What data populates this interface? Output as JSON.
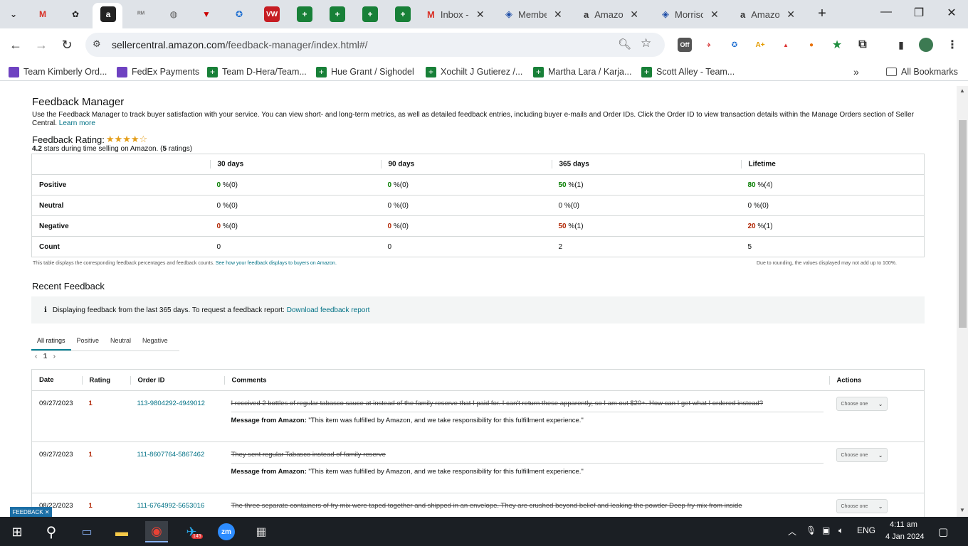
{
  "tabs": {
    "named": [
      {
        "label": "Inbox -",
        "icon": "gmail-icon"
      },
      {
        "label": "Membe",
        "icon": "diamond-icon"
      },
      {
        "label": "Amazo",
        "icon": "amazon-icon"
      },
      {
        "label": "Morriso",
        "icon": "diamond-icon"
      },
      {
        "label": "Amazo",
        "icon": "amazon-icon"
      }
    ]
  },
  "browser": {
    "url_domain": "sellercentral.amazon.com",
    "url_path": "/feedback-manager/index.html#/"
  },
  "bookmarks": [
    {
      "label": "Team Kimberly Ord..."
    },
    {
      "label": "FedEx Payments"
    },
    {
      "label": "Team D-Hera/Team..."
    },
    {
      "label": "Hue Grant / Sighodel"
    },
    {
      "label": "Xochilt J Gutierez /..."
    },
    {
      "label": "Martha Lara / Karja..."
    },
    {
      "label": "Scott Alley - Team..."
    }
  ],
  "bookmarks_all": "All Bookmarks",
  "page": {
    "title": "Feedback Manager",
    "description": "Use the Feedback Manager to track buyer satisfaction with your service. You can view short- and long-term metrics, as well as detailed feedback entries, including buyer e-mails and Order IDs. Click the Order ID to view transaction details within the Manage Orders section of Seller Central.",
    "learn_more": "Learn more",
    "rating_label": "Feedback Rating:",
    "rating_stars": "★★★★☆",
    "rating_value": "4.2",
    "rating_text_a": " stars during time selling on Amazon. (",
    "rating_count": "5",
    "rating_text_b": " ratings)"
  },
  "metrics": {
    "headers": [
      "30 days",
      "90 days",
      "365 days",
      "Lifetime"
    ],
    "rows": [
      {
        "label": "Positive",
        "cells": [
          [
            "0",
            "%(0)"
          ],
          [
            "0",
            "%(0)"
          ],
          [
            "50",
            "%(1)"
          ],
          [
            "80",
            "%(4)"
          ]
        ]
      },
      {
        "label": "Neutral",
        "cells": [
          [
            "0",
            "%(0)"
          ],
          [
            "0",
            "%(0)"
          ],
          [
            "0",
            "%(0)"
          ],
          [
            "0",
            "%(0)"
          ]
        ]
      },
      {
        "label": "Negative",
        "cells": [
          [
            "0",
            "%(0)"
          ],
          [
            "0",
            "%(0)"
          ],
          [
            "50",
            "%(1)"
          ],
          [
            "20",
            "%(1)"
          ]
        ]
      },
      {
        "label": "Count",
        "cells": [
          [
            "0",
            ""
          ],
          [
            "0",
            ""
          ],
          [
            "2",
            ""
          ],
          [
            "5",
            ""
          ]
        ]
      }
    ],
    "footnote_left": "This table displays the corresponding feedback percentages and feedback counts.",
    "footnote_link": "See how your feedback displays to buyers on Amazon.",
    "footnote_right": "Due to rounding, the values displayed may not add up to 100%."
  },
  "recent": {
    "title": "Recent Feedback",
    "info": "Displaying feedback from the last 365 days. To request a feedback report:",
    "info_link": "Download feedback report",
    "tabs": [
      "All ratings",
      "Positive",
      "Neutral",
      "Negative"
    ],
    "page": "1",
    "columns": [
      "Date",
      "Rating",
      "Order ID",
      "Comments",
      "Actions"
    ],
    "rows": [
      {
        "date": "09/27/2023",
        "rating": "1",
        "order": "113-9804292-4949012",
        "comment": "I received 2 bottles of regular tabasco sauce at instead of the family reserve that I paid for. I can't return these apparently, so I am out $20+. How can I get what I ordered instead?",
        "msg_label": "Message from Amazon:",
        "msg": "\"This item was fulfilled by Amazon, and we take responsibility for this fulfillment experience.\"",
        "action": "Choose one"
      },
      {
        "date": "09/27/2023",
        "rating": "1",
        "order": "111-8607764-5867462",
        "comment": "They sent regular Tabasco instead of family reserve",
        "msg_label": "Message from Amazon:",
        "msg": "\"This item was fulfilled by Amazon, and we take responsibility for this fulfillment experience.\"",
        "action": "Choose one"
      },
      {
        "date": "08/22/2023",
        "rating": "1",
        "order": "111-6764992-5653016",
        "comment": "The three separate containers of fry mix were taped together and shipped in an envelope. They are crushed beyond belief and leaking the powder Deep fry mix from inside",
        "msg_label": "",
        "msg": "",
        "action": "Choose one"
      }
    ],
    "feedback_tag": "FEEDBACK"
  },
  "taskbar": {
    "lang": "ENG",
    "time": "4:11 am",
    "date": "4 Jan 2024",
    "telegram_badge": "145"
  },
  "colors": {
    "positive": "#067d00",
    "negative": "#b12704",
    "link": "#007185",
    "star": "#e49e1a"
  }
}
